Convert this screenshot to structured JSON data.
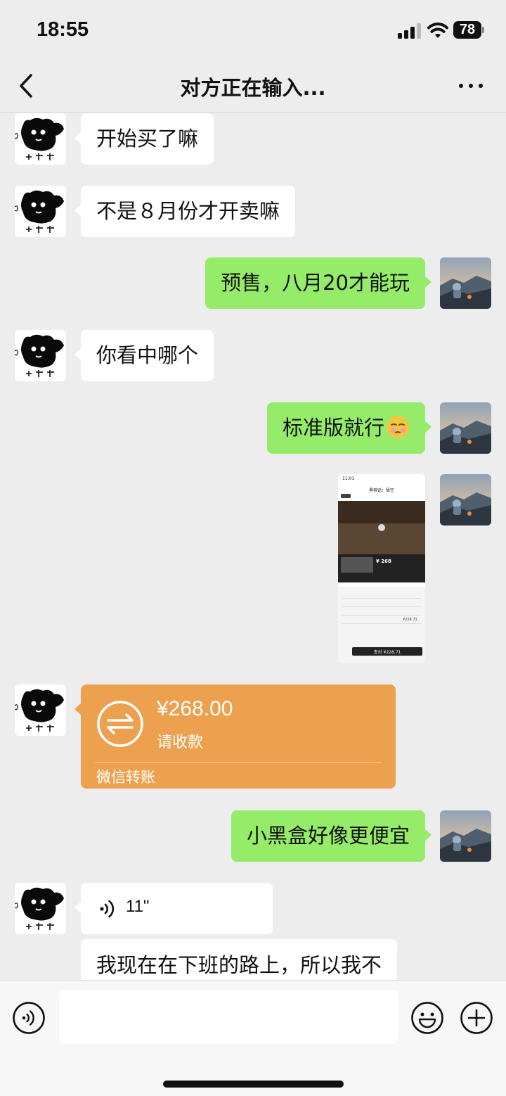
{
  "status_bar": {
    "time": "18:55",
    "battery": "78"
  },
  "nav": {
    "title": "对方正在输入...",
    "back_icon": "chevron-left-icon",
    "more_icon": "more-horizontal-icon"
  },
  "messages": [
    {
      "side": "in",
      "type": "text",
      "text": "开始买了嘛"
    },
    {
      "side": "in",
      "type": "text",
      "text": "不是８月份才开卖嘛"
    },
    {
      "side": "out",
      "type": "text",
      "text": "预售，八月20才能玩"
    },
    {
      "side": "in",
      "type": "text",
      "text": "你看中哪个"
    },
    {
      "side": "out",
      "type": "text",
      "text": "标准版就行",
      "emoji": "smirking-face-emoji"
    },
    {
      "side": "out",
      "type": "image",
      "screenshot": {
        "time": "11:01",
        "title": "黑神话：悟空",
        "price": "¥ 268",
        "pay_label": "支付 ¥228.71",
        "detail_price": "¥228.71"
      }
    },
    {
      "side": "in",
      "type": "transfer",
      "amount": "¥268.00",
      "note": "请收款",
      "footer": "微信转账",
      "icon": "transfer-arrows-icon"
    },
    {
      "side": "out",
      "type": "text",
      "text": "小黑盒好像更便宜"
    },
    {
      "side": "in",
      "type": "voice",
      "duration": "11\"",
      "icon": "voice-wave-icon"
    },
    {
      "side": "in",
      "type": "text",
      "text": "我现在在下班的路上，所以我不"
    }
  ],
  "input_bar": {
    "voice_icon": "voice-mode-icon",
    "emoji_icon": "emoji-icon",
    "plus_icon": "add-icon",
    "placeholder": ""
  },
  "colors": {
    "background": "#ededed",
    "outgoing_bubble": "#95ec69",
    "incoming_bubble": "#ffffff",
    "transfer_card": "#eda14f"
  }
}
